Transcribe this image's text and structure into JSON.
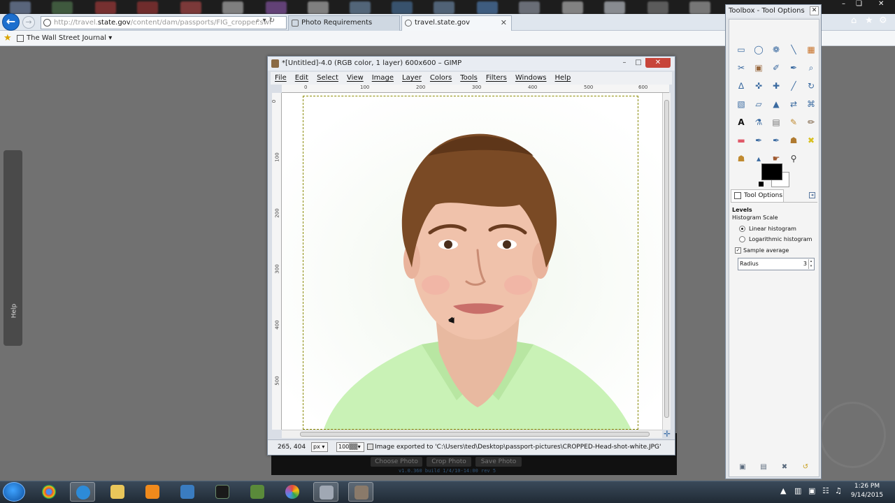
{
  "browser": {
    "address": {
      "prefix": "http://travel.",
      "domain": "state.gov",
      "path": "/content/dam/passports/FIG_cropper.swf"
    },
    "tabs": [
      {
        "label": "Photo Requirements",
        "active": false
      },
      {
        "label": "travel.state.gov",
        "active": true
      }
    ],
    "favorites": [
      {
        "label": "The Wall Street Journal ▾"
      }
    ],
    "right_icons": [
      "home-icon",
      "star-icon",
      "gear-icon"
    ]
  },
  "page": {
    "help_tab": "Help",
    "buttons": [
      "Choose Photo",
      "Crop Photo",
      "Save Photo"
    ],
    "version": "v1.0.360 build 1/4/10-14:00 rev 5"
  },
  "gimp": {
    "title": "*[Untitled]-4.0 (RGB color, 1 layer) 600x600 – GIMP",
    "menu": [
      "File",
      "Edit",
      "Select",
      "View",
      "Image",
      "Layer",
      "Colors",
      "Tools",
      "Filters",
      "Windows",
      "Help"
    ],
    "ruler_top": [
      "0",
      "100",
      "200",
      "300",
      "400",
      "500",
      "600"
    ],
    "ruler_left": [
      "0",
      "100",
      "200",
      "300",
      "400",
      "500"
    ],
    "status": {
      "coords": "265, 404",
      "unit": "px ▾",
      "zoom": "100▒▒▾",
      "message": "Image exported to 'C:\\Users\\ted\\Desktop\\passport-pictures\\CROPPED-Head-shot-white.JPG'"
    },
    "window_buttons": [
      "–",
      "□",
      "✕"
    ]
  },
  "toolbox": {
    "title": "Toolbox - Tool Options",
    "close": "✕",
    "tab_label": "Tool Options",
    "options": {
      "section": "Levels",
      "group": "Histogram Scale",
      "radios": [
        {
          "label": "Linear histogram",
          "checked": true
        },
        {
          "label": "Logarithmic histogram",
          "checked": false
        }
      ],
      "checkbox": {
        "label": "Sample average",
        "checked": true
      },
      "radius_label": "Radius",
      "radius_value": "3"
    },
    "tools": [
      "rect-select-icon",
      "ellipse-select-icon",
      "free-select-icon",
      "fuzzy-select-icon",
      "color-select-icon",
      "scissors-select-icon",
      "foreground-select-icon",
      "paths-icon",
      "color-picker-icon",
      "zoom-icon",
      "measure-icon",
      "move-icon",
      "align-icon",
      "crop-icon",
      "rotate-icon",
      "scale-icon",
      "shear-icon",
      "perspective-icon",
      "flip-icon",
      "cage-transform-icon",
      "text-icon",
      "bucket-fill-icon",
      "blend-icon",
      "pencil-icon",
      "paintbrush-icon",
      "eraser-icon",
      "airbrush-icon",
      "ink-icon",
      "clone-icon",
      "heal-icon",
      "perspective-clone-icon",
      "blur-icon",
      "smudge-icon",
      "dodge-burn-icon"
    ]
  },
  "system": {
    "time": "1:26 PM",
    "date": "9/14/2015",
    "window_controls": [
      "–",
      "❏",
      "✕"
    ]
  },
  "colors": {
    "ie_accent": "#1d6fce",
    "close_red": "#c7453a",
    "shirt_green": "#c7f2b4",
    "hair_brown": "#7a4a25"
  }
}
